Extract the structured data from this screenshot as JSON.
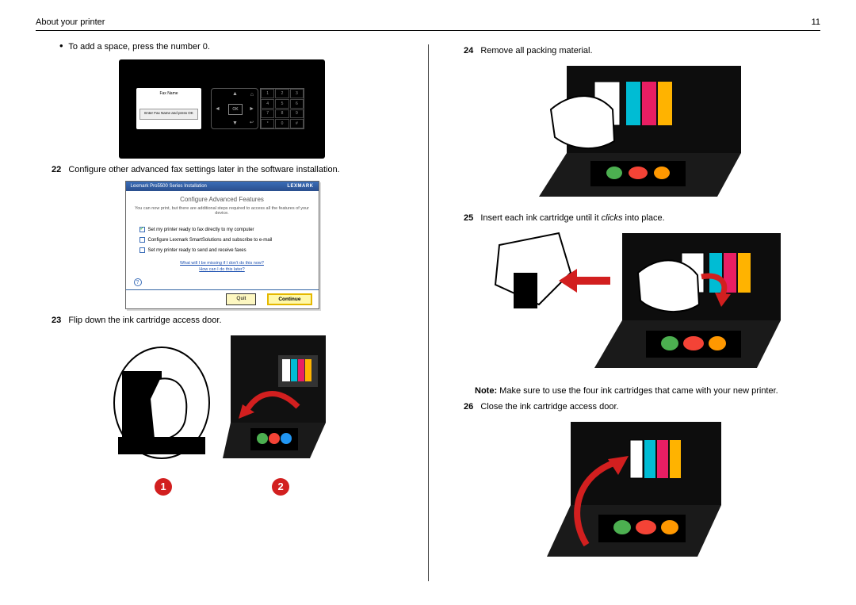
{
  "header": {
    "title": "About your printer",
    "page_number": "11"
  },
  "left": {
    "bullet1": "To add a space, press the number 0.",
    "panel": {
      "screen_label": "Fax Name",
      "screen_hint": "Enter Fax Name and press OK",
      "ok_label": "OK",
      "numpad": [
        "1",
        "2",
        "3",
        "4",
        "5",
        "6",
        "7",
        "8",
        "9",
        "*",
        "0",
        "#"
      ]
    },
    "step22_num": "22",
    "step22_text": "Configure other advanced fax settings later in the software installation.",
    "dialog": {
      "titlebar_left": "Lexmark Pro5500 Series Installation",
      "titlebar_brand": "LEXMARK",
      "heading": "Configure Advanced Features",
      "sub": "You can now print, but there are additional steps required to access all the features of your device.",
      "opt1": "Set my printer ready to fax directly to my computer",
      "opt2": "Configure Lexmark SmartSolutions and subscribe to e-mail",
      "opt3": "Set my printer ready to send and receive faxes",
      "link1": "What will I be missing if I don't do this now?",
      "link2": "How can I do this later?",
      "help": "?",
      "btn_quit": "Quit",
      "btn_continue": "Continue"
    },
    "step23_num": "23",
    "step23_text": "Flip down the ink cartridge access door.",
    "badge1": "1",
    "badge2": "2"
  },
  "right": {
    "step24_num": "24",
    "step24_text": "Remove all packing material.",
    "step25_num": "25",
    "step25_text_a": "Insert each ink cartridge until it ",
    "step25_text_b": "clicks",
    "step25_text_c": " into place.",
    "note_label": "Note:",
    "note_text": " Make sure to use the four ink cartridges that came with your new printer.",
    "step26_num": "26",
    "step26_text": "Close the ink cartridge access door."
  }
}
